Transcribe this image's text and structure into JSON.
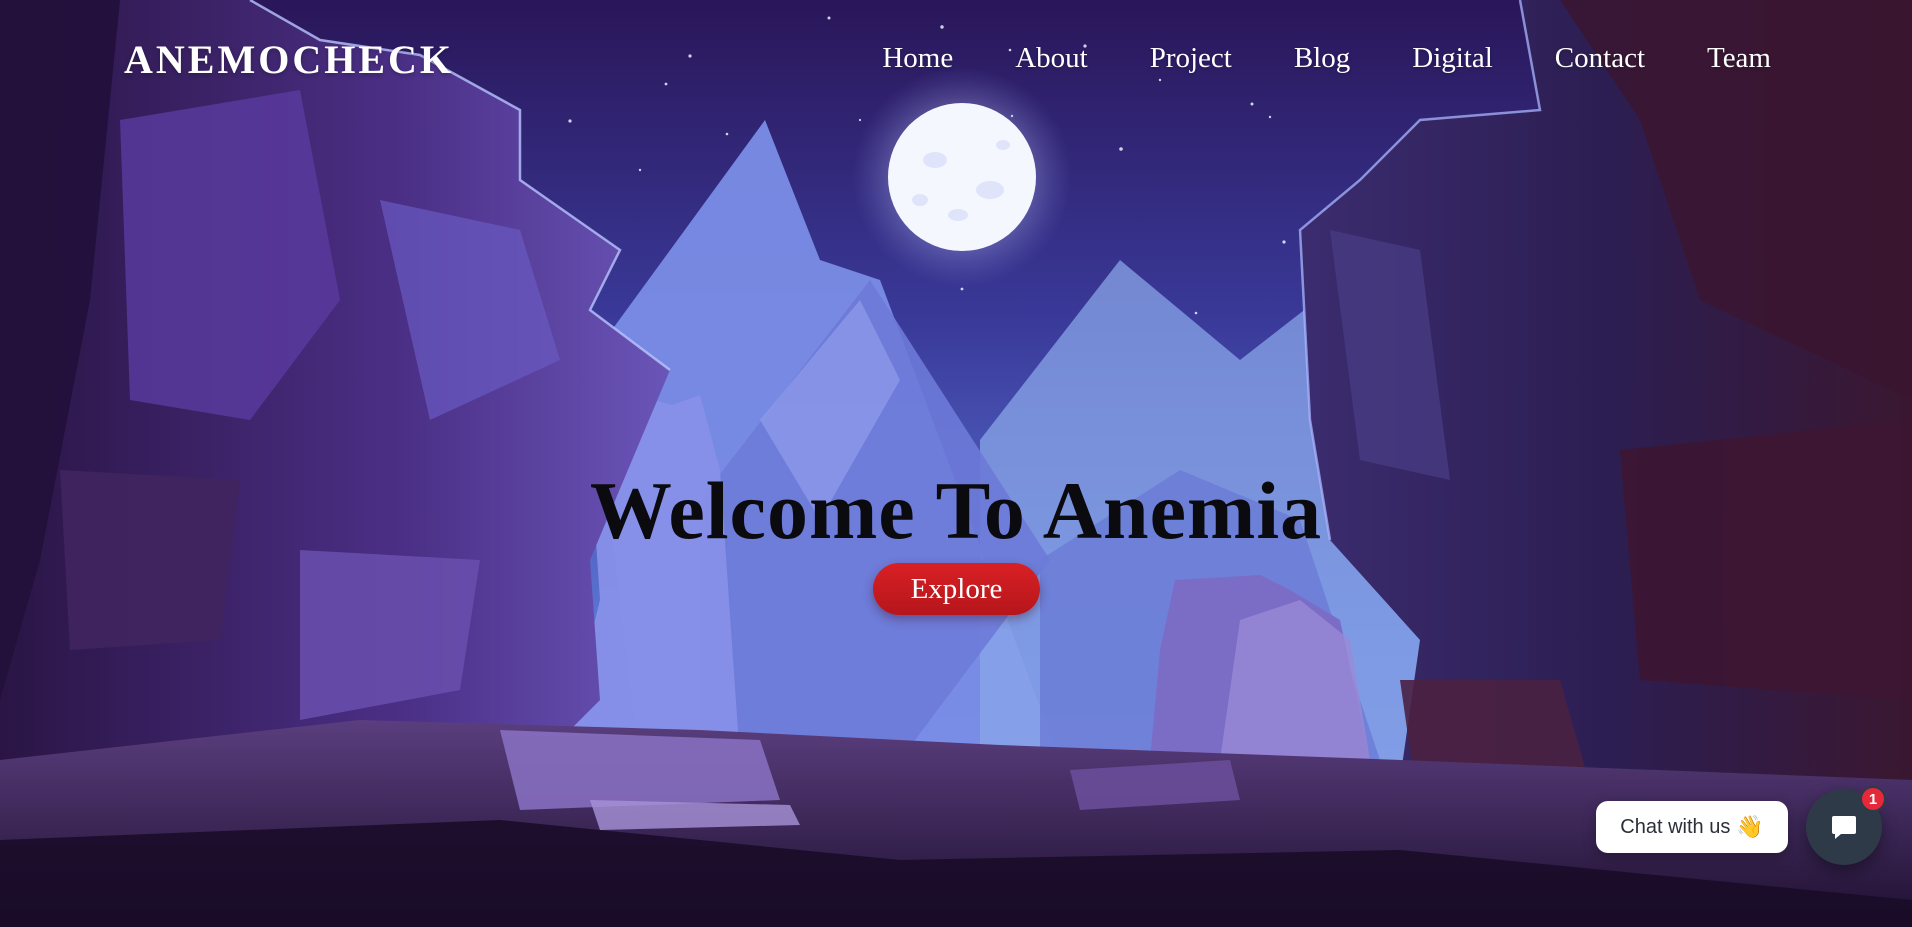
{
  "header": {
    "logo": "ANEMOCHECK",
    "nav": [
      {
        "label": "Home"
      },
      {
        "label": "About"
      },
      {
        "label": "Project"
      },
      {
        "label": "Blog"
      },
      {
        "label": "Digital"
      },
      {
        "label": "Contact"
      },
      {
        "label": "Team"
      }
    ]
  },
  "hero": {
    "title": "Welcome To Anemia",
    "cta_label": "Explore"
  },
  "chat": {
    "bubble_text": "Chat with us",
    "bubble_emoji": "👋",
    "unread_count": "1",
    "icon": "chat-message-icon"
  },
  "colors": {
    "sky_top": "#2a1659",
    "sky_mid": "#4a55c8",
    "moon": "#f3f5ff",
    "cta": "#d01c22",
    "chat_launcher": "#2f3a48",
    "badge": "#e5283a"
  }
}
